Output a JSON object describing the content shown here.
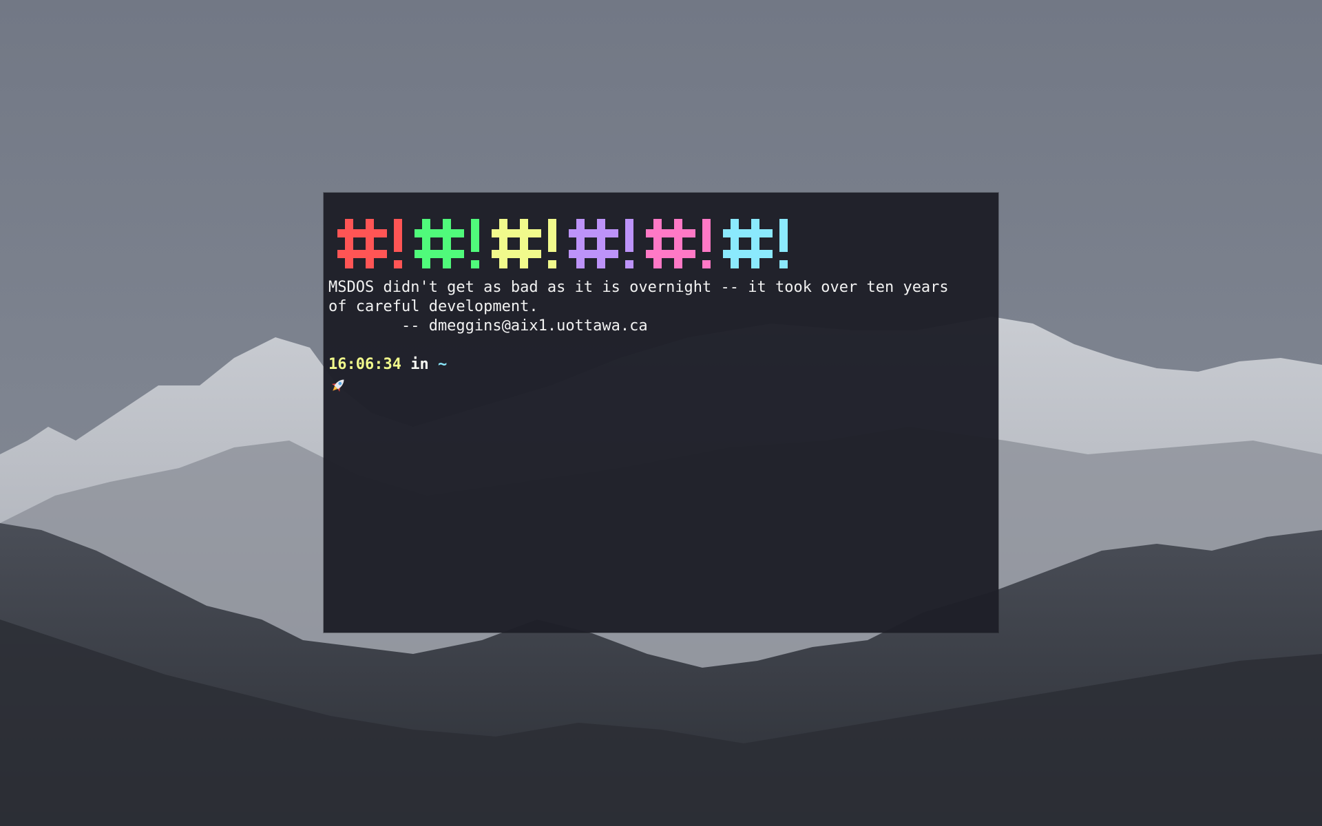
{
  "desktop": {
    "wallpaper": "snowy-mountains"
  },
  "terminal": {
    "banner": {
      "glyph_pair": "#!",
      "colors": [
        "#ff5555",
        "#50fa7b",
        "#f1fa8c",
        "#bd93f9",
        "#ff79c6",
        "#8be9fd"
      ]
    },
    "fortune": {
      "line1": "MSDOS didn't get as bad as it is overnight -- it took over ten years",
      "line2": "of careful development.",
      "line3": "        -- dmeggins@aix1.uottawa.ca"
    },
    "prompt": {
      "time": "16:06:34",
      "in_word": "in",
      "directory": "~",
      "symbol_icon": "rocket-icon"
    }
  }
}
